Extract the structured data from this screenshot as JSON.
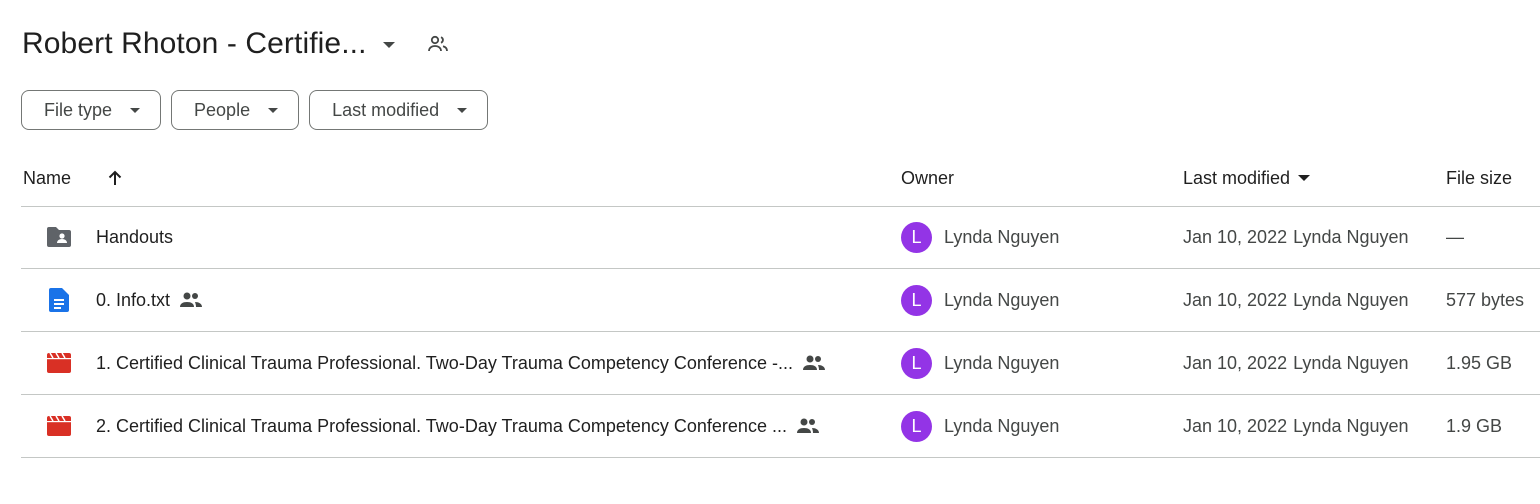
{
  "header": {
    "title": "Robert Rhoton - Certifie...",
    "title_caret_icon": "arrow-drop-down-icon",
    "shared_icon": "people-icon"
  },
  "filters": [
    {
      "label": "File type"
    },
    {
      "label": "People"
    },
    {
      "label": "Last modified"
    }
  ],
  "table": {
    "columns": {
      "name": "Name",
      "owner": "Owner",
      "last_modified": "Last modified",
      "file_size": "File size"
    },
    "rows": [
      {
        "name": "Handouts",
        "type_icon": "shared-folder-icon",
        "shared": false,
        "owner_initial": "L",
        "owner": "Lynda Nguyen",
        "date": "Jan 10, 2022",
        "modified_by": "Lynda Nguyen",
        "size": "—"
      },
      {
        "name": "0. Info.txt",
        "type_icon": "document-icon",
        "shared": true,
        "owner_initial": "L",
        "owner": "Lynda Nguyen",
        "date": "Jan 10, 2022",
        "modified_by": "Lynda Nguyen",
        "size": "577 bytes"
      },
      {
        "name": "1. Certified Clinical Trauma Professional.  Two-Day Trauma Competency Conference -...",
        "type_icon": "video-icon",
        "shared": true,
        "owner_initial": "L",
        "owner": "Lynda Nguyen",
        "date": "Jan 10, 2022",
        "modified_by": "Lynda Nguyen",
        "size": "1.95 GB"
      },
      {
        "name": "2. Certified Clinical Trauma Professional.  Two-Day Trauma Competency Conference ...",
        "type_icon": "video-icon",
        "shared": true,
        "owner_initial": "L",
        "owner": "Lynda Nguyen",
        "date": "Jan 10, 2022",
        "modified_by": "Lynda Nguyen",
        "size": "1.9 GB"
      }
    ]
  },
  "colors": {
    "avatar": "#9334e6",
    "folder_icon": "#5f6368",
    "doc_icon": "#1a73e8",
    "video_icon": "#d93025",
    "border": "#c4c7c5"
  }
}
